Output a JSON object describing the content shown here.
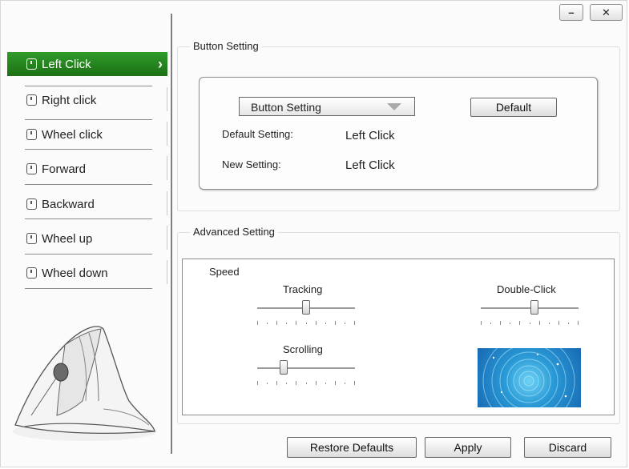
{
  "window": {
    "minimize_label": "–",
    "close_label": "✕"
  },
  "sidebar": {
    "items": [
      {
        "label": "Left Click"
      },
      {
        "label": "Right click"
      },
      {
        "label": "Wheel click"
      },
      {
        "label": "Forward"
      },
      {
        "label": "Backward"
      },
      {
        "label": "Wheel up"
      },
      {
        "label": "Wheel down"
      }
    ],
    "active_index": 0,
    "active_color": "#2a8a22"
  },
  "button_setting": {
    "group_title": "Button Setting",
    "dropdown_value": "Button Setting",
    "default_button": "Default",
    "default_setting_label": "Default Setting:",
    "default_setting_value": "Left Click",
    "new_setting_label": "New Setting:",
    "new_setting_value": "Left Click"
  },
  "advanced_setting": {
    "group_title": "Advanced Setting",
    "speed_label": "Speed",
    "tracking_label": "Tracking",
    "tracking_level": 0.5,
    "scrolling_label": "Scrolling",
    "scrolling_level": 0.25,
    "double_click_label": "Double-Click",
    "double_click_level": 0.55
  },
  "footer": {
    "restore_defaults": "Restore Defaults",
    "apply": "Apply",
    "discard": "Discard"
  }
}
